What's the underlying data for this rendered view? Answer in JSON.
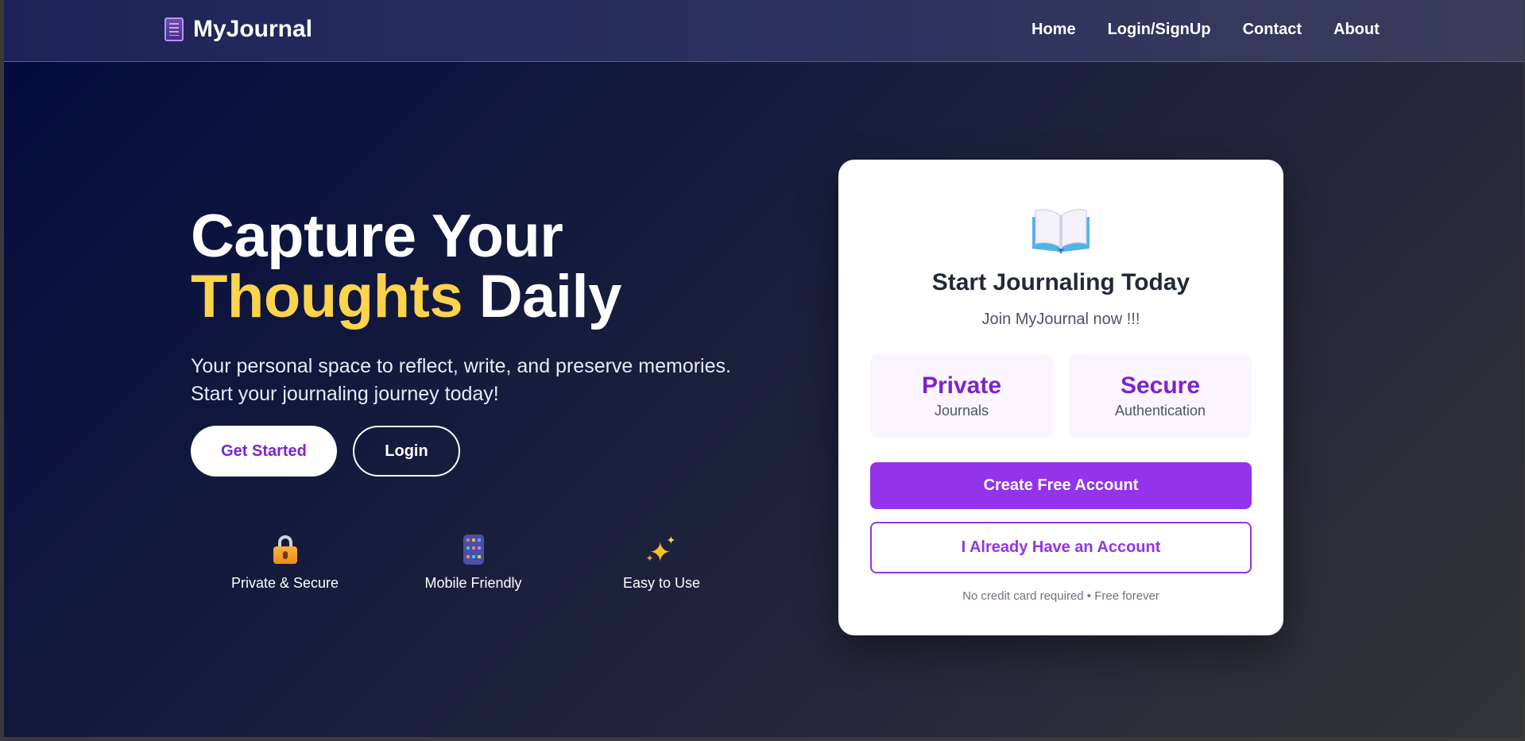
{
  "brand": {
    "name": "MyJournal",
    "icon": "notebook-icon"
  },
  "nav": {
    "items": [
      {
        "label": "Home"
      },
      {
        "label": "Login/SignUp"
      },
      {
        "label": "Contact"
      },
      {
        "label": "About"
      }
    ]
  },
  "hero": {
    "title_line1": "Capture Your",
    "title_accent": "Thoughts",
    "title_rest": "Daily",
    "subtitle_line1": "Your personal space to reflect, write, and preserve memories.",
    "subtitle_line2": "Start your journaling journey today!",
    "get_started_label": "Get Started",
    "login_label": "Login"
  },
  "features": [
    {
      "label": "Private & Secure",
      "icon": "lock-icon"
    },
    {
      "label": "Mobile Friendly",
      "icon": "mobile-phone-icon"
    },
    {
      "label": "Easy to Use",
      "icon": "sparkles-icon"
    }
  ],
  "card": {
    "icon": "open-book-icon",
    "title": "Start Journaling Today",
    "subtitle": "Join MyJournal now !!!",
    "stats": [
      {
        "title": "Private",
        "desc": "Journals"
      },
      {
        "title": "Secure",
        "desc": "Authentication"
      }
    ],
    "create_label": "Create Free Account",
    "have_account_label": "I Already Have an Account",
    "footnote": "No credit card required • Free forever"
  },
  "colors": {
    "accent_yellow": "#fcd34d",
    "brand_purple": "#9333ea",
    "purple_text": "#7e22ce"
  }
}
